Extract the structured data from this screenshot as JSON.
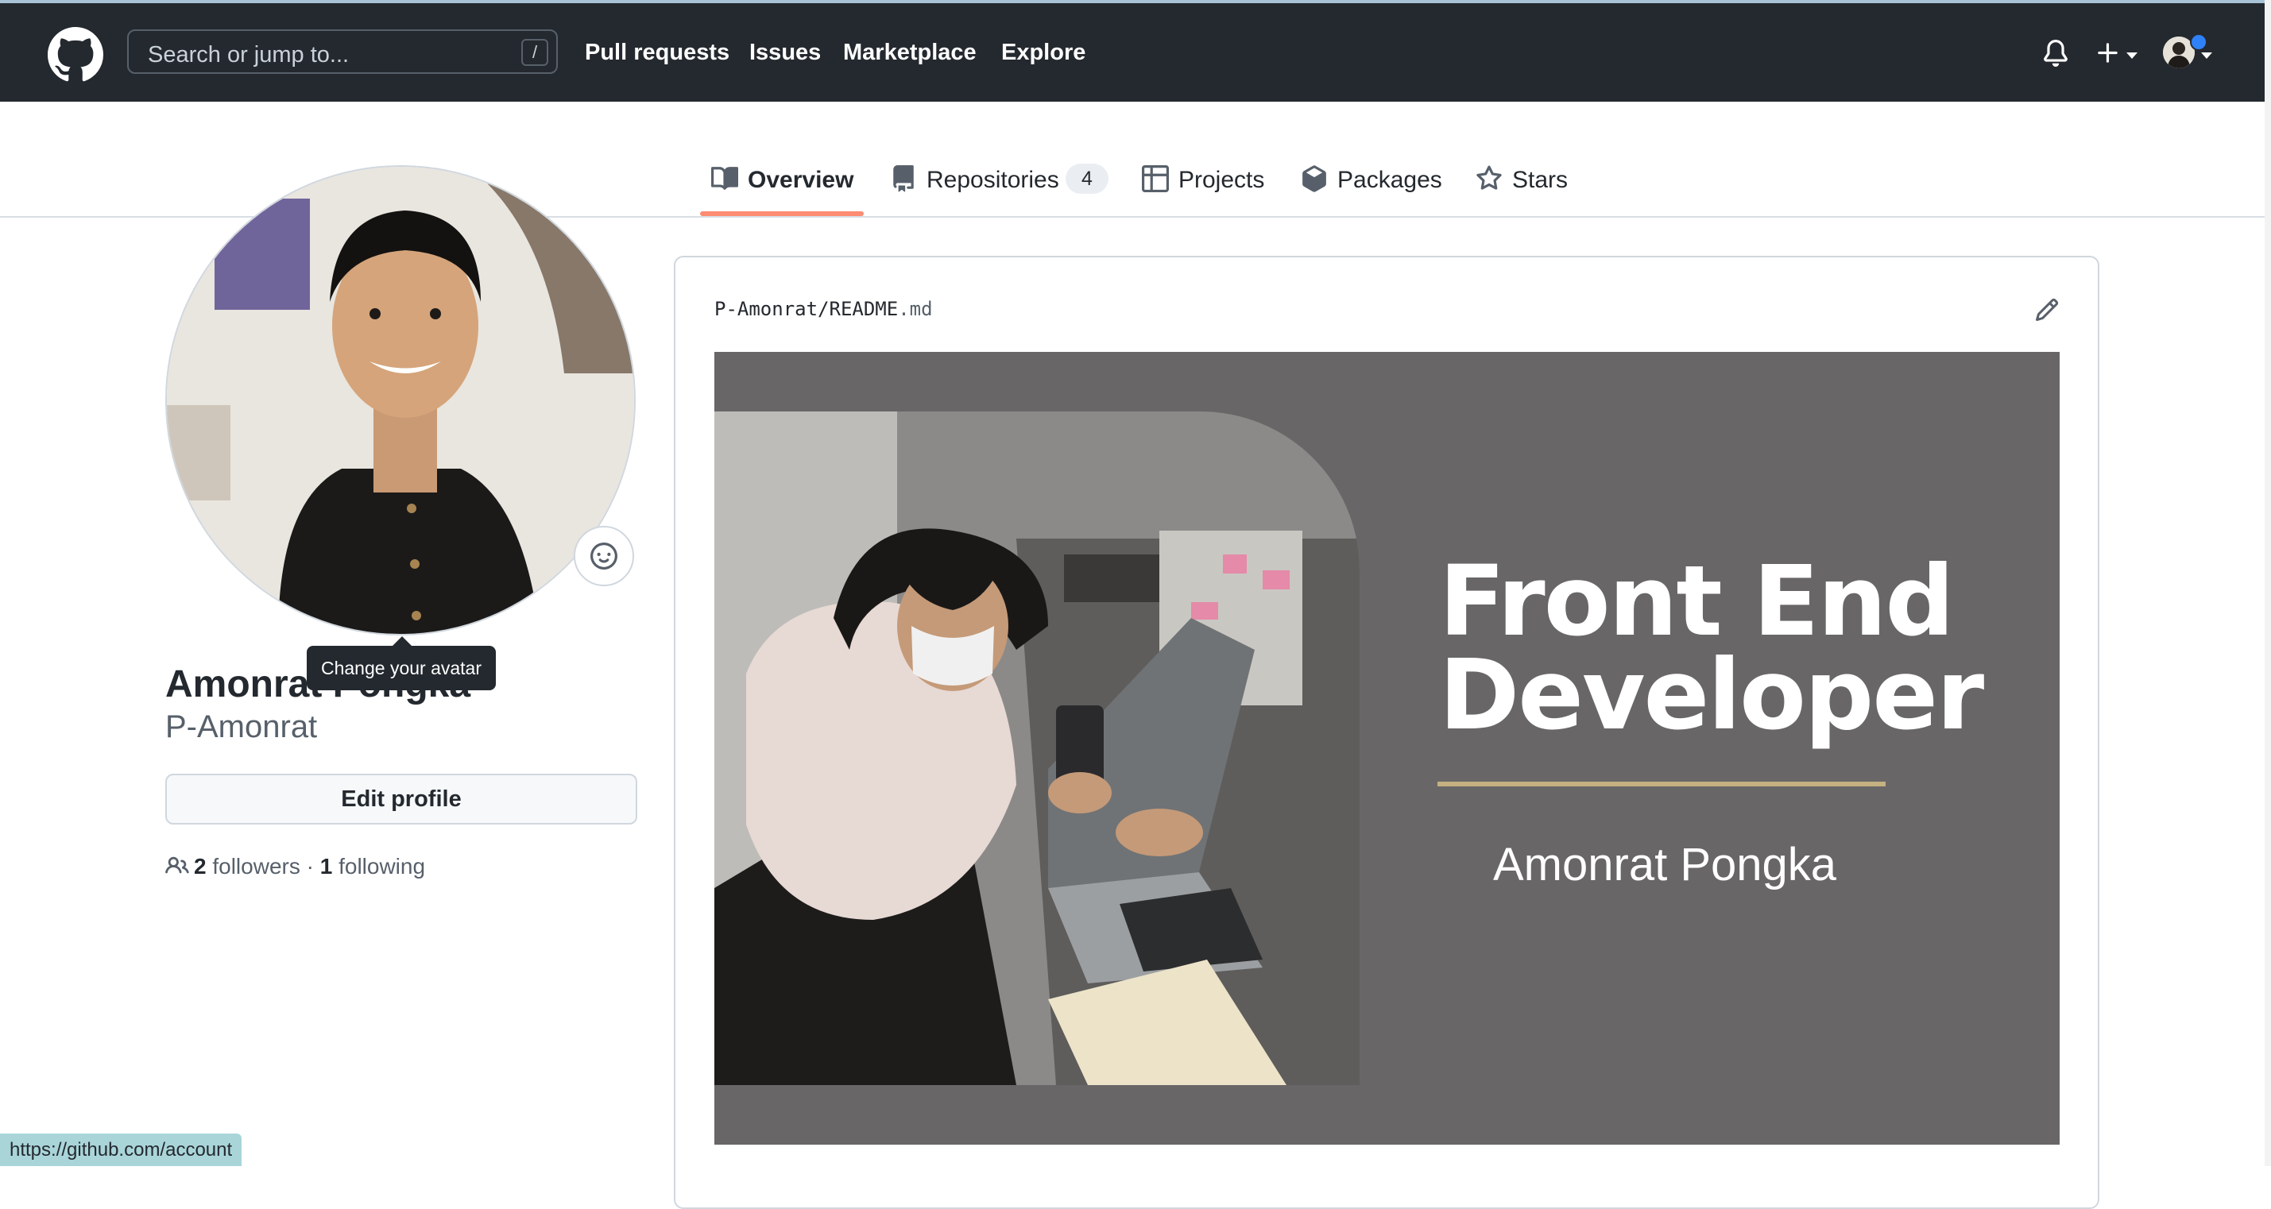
{
  "header": {
    "search_placeholder": "Search or jump to...",
    "search_shortcut": "/",
    "nav": [
      "Pull requests",
      "Issues",
      "Marketplace",
      "Explore"
    ]
  },
  "tabs": [
    {
      "label": "Overview"
    },
    {
      "label": "Repositories",
      "count": "4"
    },
    {
      "label": "Projects"
    },
    {
      "label": "Packages"
    },
    {
      "label": "Stars"
    }
  ],
  "profile": {
    "tooltip": "Change your avatar",
    "fullname": "Amonrat Pongka",
    "username": "P-Amonrat",
    "edit_label": "Edit profile",
    "followers_count": "2",
    "followers_label": "followers",
    "separator": "·",
    "following_count": "1",
    "following_label": "following"
  },
  "readme": {
    "owner": "P-Amonrat",
    "sep": "/",
    "file": "README",
    "ext": ".md",
    "banner_title_line1": "Front End",
    "banner_title_line2": "Developer",
    "banner_name": "Amonrat Pongka"
  },
  "status_bar": {
    "url": "https://github.com/account"
  },
  "colors": {
    "header_bg": "#24292f",
    "tab_accent": "#fd8c73",
    "banner_bg": "#686667",
    "banner_rule": "#c5b080"
  }
}
